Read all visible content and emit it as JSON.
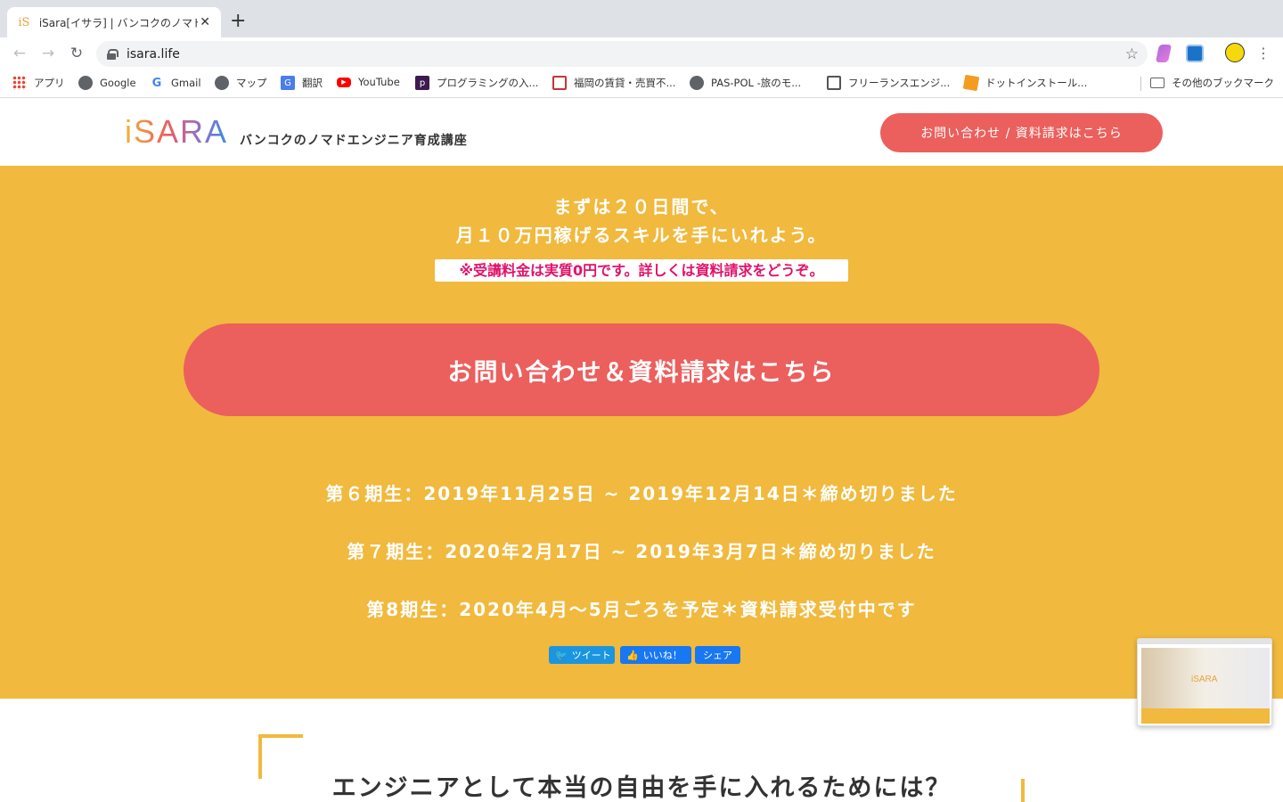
{
  "browser": {
    "tab_title": "iSara[イサラ] | バンコクのノマドエンジニア育成講座",
    "tab_favicon": "iS",
    "url": "isara.life"
  },
  "bookmarks": [
    {
      "label": "アプリ",
      "icon": "apps-grid-icon"
    },
    {
      "label": "Google",
      "icon": "globe-icon"
    },
    {
      "label": "Gmail",
      "icon": "google-icon"
    },
    {
      "label": "マップ",
      "icon": "globe-icon"
    },
    {
      "label": "翻訳",
      "icon": "translate-icon"
    },
    {
      "label": "YouTube",
      "icon": "youtube-icon"
    },
    {
      "label": "プログラミングの入...",
      "icon": "progate-icon"
    },
    {
      "label": "福岡の賃貸・売買不...",
      "icon": "home-icon"
    },
    {
      "label": "PAS-POL -旅のモ...",
      "icon": "globe-icon"
    },
    {
      "label": "フリーランスエンジ...",
      "icon": "house-icon"
    },
    {
      "label": "ドットインストール...",
      "icon": "dotinstall-icon"
    },
    {
      "label": "その他のブックマーク",
      "icon": "folder-icon"
    }
  ],
  "site": {
    "logo_text": "iSARA",
    "tagline": "バンコクのノマドエンジニア育成講座",
    "header_cta": "お問い合わせ / 資料請求はこちら"
  },
  "hero": {
    "line1": "まずは２０日間で、",
    "line2": "月１０万円稼げるスキルを手にいれよう。",
    "notice": "※受講料金は実質0円です。詳しくは資料請求をどうぞ。",
    "cta": "お問い合わせ＆資料請求はこちら",
    "cohorts": [
      "第６期生：2019年11月25日 ~ 2019年12月14日＊締め切りました",
      "第７期生：2020年2月17日 ~ 2019年3月7日＊締め切りました",
      "第8期生：2020年4月〜5月ごろを予定＊資料請求受付中です"
    ],
    "share": {
      "tweet": "ツイート",
      "like": "いいね！",
      "share": "シェア"
    }
  },
  "section2": {
    "title": "エンジニアとして本当の自由を手に入れるためには？"
  },
  "thumbnail": {
    "logo": "iSARA"
  },
  "colors": {
    "hero_bg": "#f1b93d",
    "cta": "#eb5f5d",
    "notice_text": "#e2126a",
    "twitter": "#1b95e0",
    "facebook": "#1877f2"
  }
}
